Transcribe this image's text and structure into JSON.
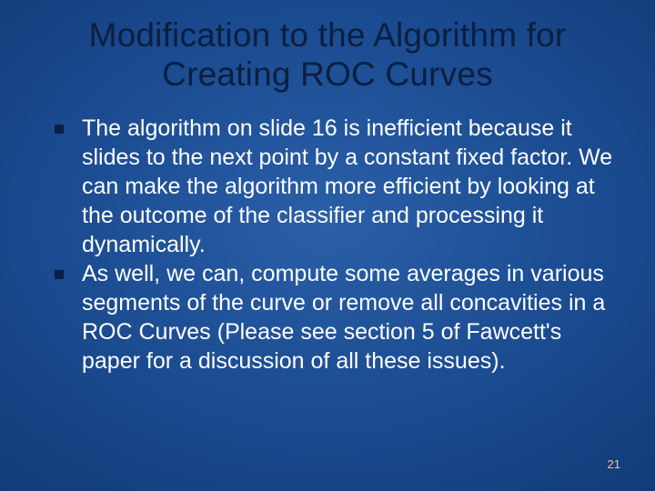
{
  "slide": {
    "title": "Modification to the Algorithm for Creating ROC Curves",
    "bullets": [
      "The algorithm on slide 16 is inefficient because it slides to the next point by a constant fixed factor. We can make the algorithm more efficient by looking at the outcome of the classifier and processing it dynamically.",
      "As well, we can, compute some averages in various segments of the curve or remove all concavities in a ROC Curves (Please see section 5 of Fawcett's paper for a discussion of all these issues)."
    ],
    "page_number": "21"
  }
}
